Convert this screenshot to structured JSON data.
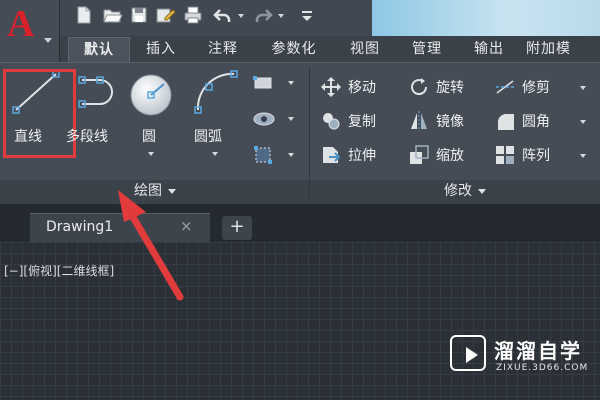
{
  "app": {
    "logo_letter": "A"
  },
  "ribbon_tabs": [
    "默认",
    "插入",
    "注释",
    "参数化",
    "视图",
    "管理",
    "输出",
    "附加模"
  ],
  "draw_panel": {
    "title": "绘图",
    "tools": {
      "line": "直线",
      "polyline": "多段线",
      "circle": "圆",
      "arc": "圆弧"
    }
  },
  "modify_panel": {
    "title": "修改",
    "tools": {
      "move": "移动",
      "rotate": "旋转",
      "trim": "修剪",
      "copy": "复制",
      "mirror": "镜像",
      "fillet": "圆角",
      "stretch": "拉伸",
      "scale": "缩放",
      "array": "阵列"
    }
  },
  "drawing_tab": {
    "name": "Drawing1",
    "close": "×",
    "add": "+"
  },
  "viewport_label": "[−][俯视][二维线框]",
  "watermark": {
    "name": "溜溜自学",
    "url": "ZIXUE.3D66.COM"
  },
  "colors": {
    "accent_red": "#e23b3b",
    "logo_red": "#d8212a",
    "ribbon": "#454c55",
    "canvas": "#2b3036"
  }
}
